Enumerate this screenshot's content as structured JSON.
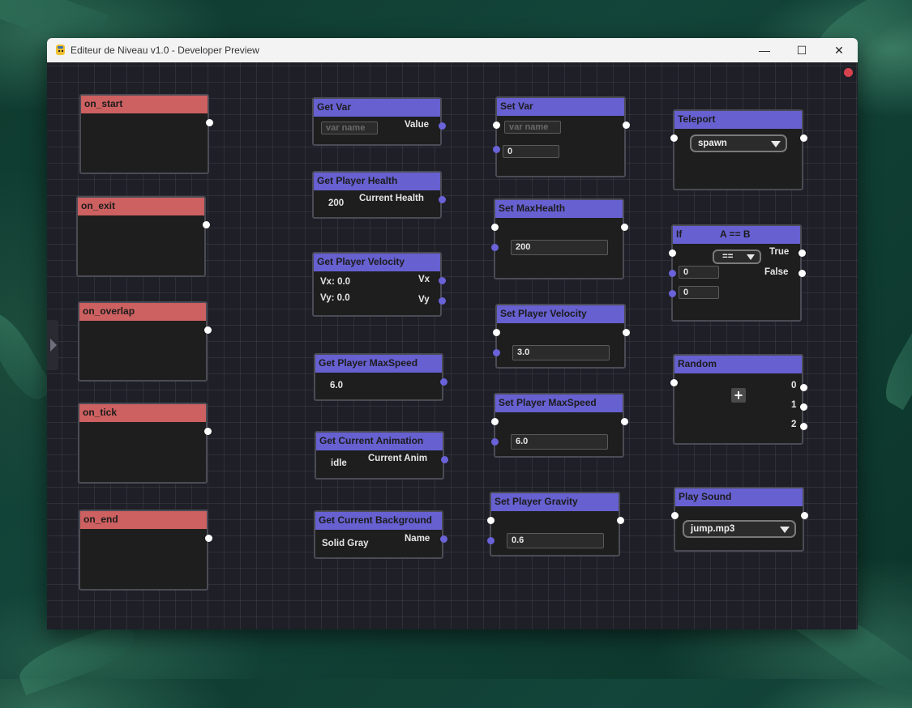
{
  "window": {
    "title": "Editeur de Niveau v1.0 - Developer Preview",
    "buttons": {
      "minimize": "—",
      "maximize": "☐",
      "close": "✕"
    }
  },
  "events": [
    {
      "title": "on_start"
    },
    {
      "title": "on_exit"
    },
    {
      "title": "on_overlap"
    },
    {
      "title": "on_tick"
    },
    {
      "title": "on_end"
    }
  ],
  "getters": {
    "get_var": {
      "title": "Get Var",
      "placeholder": "var name",
      "output": "Value"
    },
    "get_health": {
      "title": "Get Player Health",
      "value": "200",
      "output": "Current Health"
    },
    "get_velocity": {
      "title": "Get Player Velocity",
      "vx": "Vx: 0.0",
      "vy": "Vy: 0.0",
      "out_x": "Vx",
      "out_y": "Vy"
    },
    "get_maxspeed": {
      "title": "Get Player MaxSpeed",
      "value": "6.0"
    },
    "get_anim": {
      "title": "Get Current Animation",
      "value": "idle",
      "output": "Current Anim"
    },
    "get_bg": {
      "title": "Get Current Background",
      "value": "Solid Gray",
      "output": "Name"
    }
  },
  "setters": {
    "set_var": {
      "title": "Set Var",
      "placeholder": "var name",
      "value": "0"
    },
    "set_maxhealth": {
      "title": "Set MaxHealth",
      "value": "200"
    },
    "set_velocity": {
      "title": "Set Player Velocity",
      "value": "3.0"
    },
    "set_maxspeed": {
      "title": "Set Player MaxSpeed",
      "value": "6.0"
    },
    "set_gravity": {
      "title": "Set Player Gravity",
      "value": "0.6"
    }
  },
  "misc": {
    "teleport": {
      "title": "Teleport",
      "selected": "spawn"
    },
    "if_node": {
      "title": "If",
      "condition": "A == B",
      "operator": "==",
      "a": "0",
      "b": "0",
      "out_true": "True",
      "out_false": "False"
    },
    "random": {
      "title": "Random",
      "add": "+",
      "outputs": [
        "0",
        "1",
        "2"
      ]
    },
    "play_sound": {
      "title": "Play Sound",
      "selected": "jump.mp3"
    }
  },
  "colors": {
    "event_header": "#cd6060",
    "node_header": "#6660d0",
    "exec_pin": "#ffffff",
    "data_pin": "#6a62d8",
    "status_dot": "#d6434f"
  }
}
